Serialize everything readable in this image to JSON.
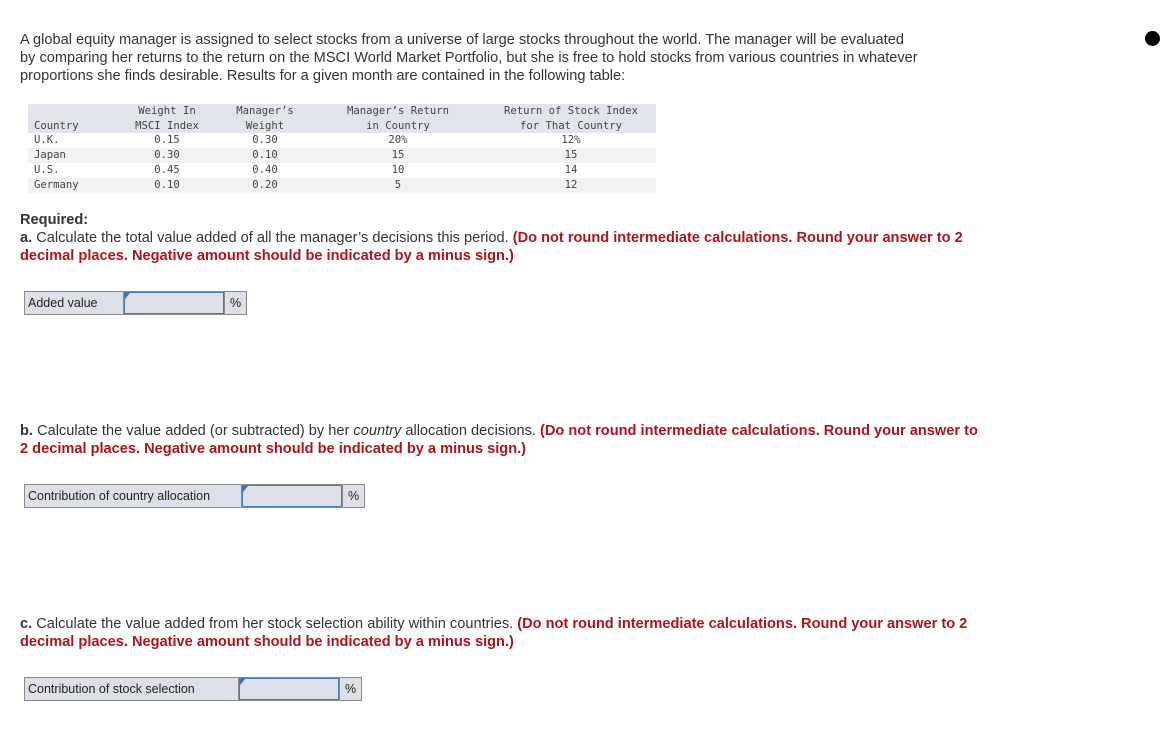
{
  "intro": "A global equity manager is assigned to select stocks from a universe of large stocks throughout the world. The manager will be evaluated by comparing her returns to the return on the MSCI World Market Portfolio, but she is free to hold stocks from various countries in whatever proportions she finds desirable. Results for a given month are contained in the following table:",
  "table": {
    "headers": [
      {
        "line1": "",
        "line2": "Country"
      },
      {
        "line1": "Weight In",
        "line2": "MSCI Index"
      },
      {
        "line1": "Manager’s",
        "line2": "Weight"
      },
      {
        "line1": "Manager’s Return",
        "line2": "in Country"
      },
      {
        "line1": "Return of Stock Index",
        "line2": "for That Country"
      }
    ],
    "rows": [
      [
        "U.K.",
        "0.15",
        "0.30",
        "20%",
        "12%"
      ],
      [
        "Japan",
        "0.30",
        "0.10",
        "15",
        "15"
      ],
      [
        "U.S.",
        "0.45",
        "0.40",
        "10",
        "14"
      ],
      [
        "Germany",
        "0.10",
        "0.20",
        "5",
        "12"
      ]
    ]
  },
  "required_heading": "Required:",
  "parts": {
    "a": {
      "letter": "a.",
      "text": " Calculate the total value added of all the manager’s decisions this period. ",
      "instruction": "(Do not round intermediate calculations. Round your answer to 2 decimal places. Negative amount should be indicated by a minus sign.)",
      "field_label": "Added value",
      "field_value": "",
      "unit": "%"
    },
    "b": {
      "letter": "b.",
      "text_before": " Calculate the value added (or subtracted) by her ",
      "text_italic": "country",
      "text_after": " allocation decisions. ",
      "instruction": "(Do not round intermediate calculations. Round your answer to 2 decimal places. Negative amount should be indicated by a minus sign.)",
      "field_label": "Contribution of country allocation",
      "field_value": "",
      "unit": "%"
    },
    "c": {
      "letter": "c.",
      "text": " Calculate the value added from her stock selection ability within countries. ",
      "instruction": "(Do not round intermediate calculations. Round your answer to 2 decimal places. Negative amount should be indicated by a minus sign.)",
      "field_label": "Contribution of stock selection",
      "field_value": "",
      "unit": "%"
    }
  }
}
